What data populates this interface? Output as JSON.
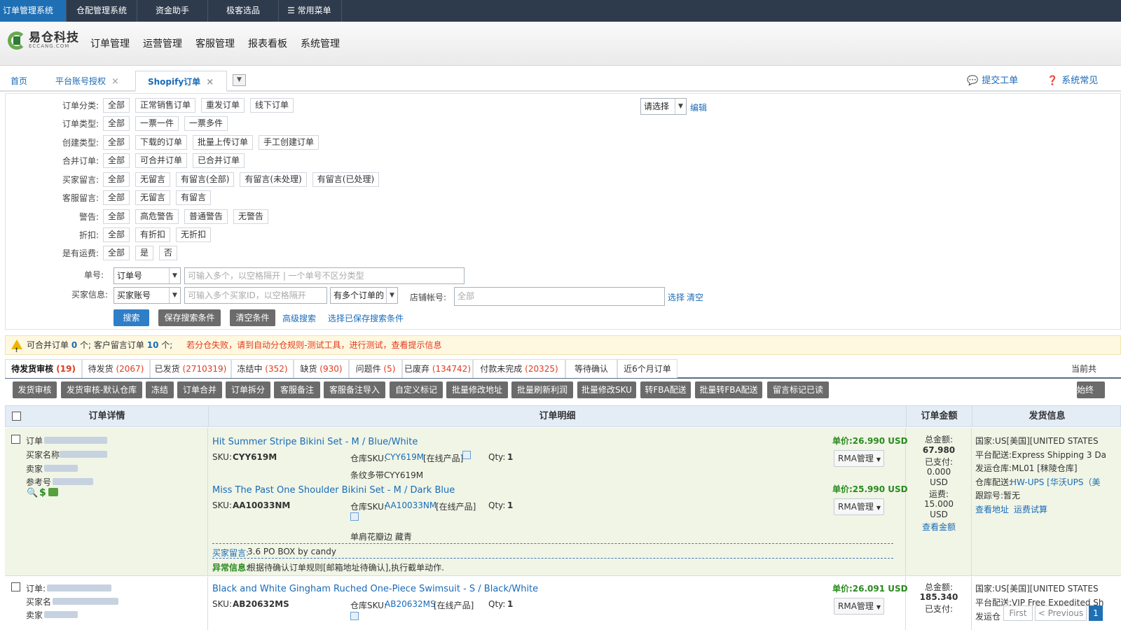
{
  "topbar": {
    "items": [
      "订单管理系统",
      "仓配管理系统",
      "资金助手",
      "极客选品",
      "常用菜单"
    ]
  },
  "header": {
    "logo_cn": "易仓科技",
    "logo_en": "ECCANG.COM",
    "nav": [
      "订单管理",
      "运营管理",
      "客服管理",
      "报表看板",
      "系统管理"
    ]
  },
  "tabs": {
    "home": "首页",
    "platform": "平台账号授权",
    "shopify": "Shopify订单",
    "close": "×",
    "submit_ticket": "提交工单",
    "faq": "系统常见"
  },
  "filters": {
    "rows": [
      {
        "label": "订单分类:",
        "options": [
          "全部",
          "正常销售订单",
          "重发订单",
          "线下订单"
        ]
      },
      {
        "label": "订单类型:",
        "options": [
          "全部",
          "一票一件",
          "一票多件"
        ]
      },
      {
        "label": "创建类型:",
        "options": [
          "全部",
          "下载的订单",
          "批量上传订单",
          "手工创建订单"
        ]
      },
      {
        "label": "合并订单:",
        "options": [
          "全部",
          "可合并订单",
          "已合并订单"
        ]
      },
      {
        "label": "买家留言:",
        "options": [
          "全部",
          "无留言",
          "有留言(全部)",
          "有留言(未处理)",
          "有留言(已处理)"
        ]
      },
      {
        "label": "客服留言:",
        "options": [
          "全部",
          "无留言",
          "有留言"
        ]
      },
      {
        "label": "警告:",
        "options": [
          "全部",
          "高危警告",
          "普通警告",
          "无警告"
        ]
      },
      {
        "label": "折扣:",
        "options": [
          "全部",
          "有折扣",
          "无折扣"
        ]
      },
      {
        "label": "是有运费:",
        "options": [
          "全部",
          "是",
          "否"
        ]
      }
    ],
    "select_placeholder": "请选择",
    "edit": "编辑",
    "order_no_label": "单号:",
    "order_no_type": "订单号",
    "order_no_placeholder": "可输入多个，以空格隔开 | 一个单号不区分类型",
    "buyer_label": "买家信息:",
    "buyer_type": "买家账号",
    "buyer_placeholder": "可输入多个买家ID，以空格隔开",
    "multi_order": "有多个订单的",
    "store_label": "店铺帐号:",
    "store_value": "全部",
    "choose": "选择",
    "clear": "清空",
    "search": "搜索",
    "save_cond": "保存搜索条件",
    "clear_cond": "清空条件",
    "advanced": "高级搜索",
    "saved_cond": "选择已保存搜索条件"
  },
  "notice": {
    "text1": "可合并订单",
    "count1": "0",
    "text2": "个; 客户留言订单",
    "count2": "10",
    "text3": "个;",
    "red": "若分仓失败，请到自动分仓规则-测试工具，进行测试，查看提示信息"
  },
  "status_tabs": [
    {
      "label": "待发货审核",
      "count": "(19)"
    },
    {
      "label": "待发货",
      "count": "(2067)"
    },
    {
      "label": "已发货",
      "count": "(2710319)"
    },
    {
      "label": "冻结中",
      "count": "(352)"
    },
    {
      "label": "缺货",
      "count": "(930)"
    },
    {
      "label": "问题件",
      "count": "(5)"
    },
    {
      "label": "已废弃",
      "count": "(134742)"
    },
    {
      "label": "付款未完成",
      "count": "(20325)"
    },
    {
      "label": "等待确认",
      "count": ""
    },
    {
      "label": "近6个月订单",
      "count": ""
    }
  ],
  "status_right": "当前共",
  "actions": [
    "发货审核",
    "发货审核-默认仓库",
    "冻结",
    "订单合并",
    "订单拆分",
    "客服备注",
    "客服备注导入",
    "自定义标记",
    "批量修改地址",
    "批量刷新利润",
    "批量修改SKU",
    "转FBA配送",
    "批量转FBA配送",
    "留言标记已读",
    "始终"
  ],
  "table": {
    "headers": [
      "订单详情",
      "订单明细",
      "订单金额",
      "发货信息"
    ]
  },
  "row1": {
    "detail_labels": [
      "订单",
      "买家名称",
      "卖家",
      "参考号"
    ],
    "items": [
      {
        "title": "Hit Summer Stripe Bikini Set - M / Blue/White",
        "sku_label": "SKU:",
        "sku": "CYY619M",
        "wh_label": "仓库SKU:",
        "wh_sku": "CYY619M",
        "wh_tag": "[在线产品]",
        "qty_label": "Qty:",
        "qty": "1",
        "note": "条纹多带CYY619M",
        "price": "单价:26.990 USD",
        "rma": "RMA管理"
      },
      {
        "title": "Miss The Past One Shoulder Bikini Set - M / Dark Blue",
        "sku_label": "SKU:",
        "sku": "AA10033NM",
        "wh_label": "仓库SKU:",
        "wh_sku": "AA10033NM",
        "wh_tag": "[在线产品]",
        "qty_label": "Qty:",
        "qty": "1",
        "note": "单肩花瓣边 藏青",
        "price": "单价:25.990 USD",
        "rma": "RMA管理"
      }
    ],
    "buyer_msg_label": "买家留言:",
    "buyer_msg": "3.6 PO BOX by candy",
    "exception_label": "异常信息:",
    "exception": "根据待确认订单规则[邮箱地址待确认],执行截单动作.",
    "amount": {
      "total_label": "总金额:",
      "total": "67.980",
      "paid_label": "已支付:",
      "paid": "0.000",
      "currency": "USD",
      "ship_label": "运费:",
      "ship": "15.000",
      "view": "查看金额"
    },
    "shipping": {
      "country": "国家:US[美国][UNITED STATES",
      "platform": "平台配送:Express Shipping 3 Da",
      "warehouse": "发运仓库:ML01 [秣陵仓库]",
      "wh_ship_label": "仓库配送:",
      "wh_ship": "HW-UPS [华沃UPS（美",
      "tracking": "跟踪号:暂无",
      "view_addr": "查看地址",
      "trial": "运费试算"
    }
  },
  "row2": {
    "detail_label": "订单:",
    "buyer_label": "买家名",
    "seller_label": "卖家",
    "title": "Black and White Gingham Ruched One-Piece Swimsuit - S / Black/White",
    "sku_label": "SKU:",
    "sku": "AB20632MS",
    "wh_label": "仓库SKU:",
    "wh_sku": "AB20632MS",
    "wh_tag": "[在线产品]",
    "qty_label": "Qty:",
    "qty": "1",
    "price": "单价:26.091 USD",
    "rma": "RMA管理",
    "total_label": "总金额:",
    "total": "185.340",
    "paid_label": "已支付:",
    "country": "国家:US[美国][UNITED STATES",
    "platform": "平台配送:VIP Free Expedited Sh",
    "warehouse": "发运仓"
  },
  "pager": {
    "first": "First",
    "prev": "< Previous",
    "page": "1"
  }
}
